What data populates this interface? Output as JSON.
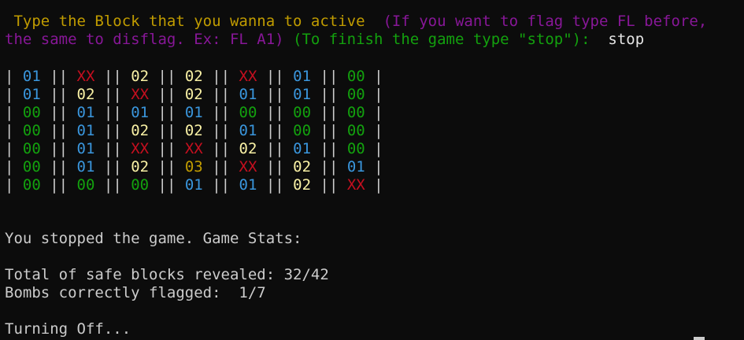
{
  "colors": {
    "background": "#0c0c0c",
    "prompt_gold": "#c19c00",
    "prompt_purple": "#881798",
    "prompt_green": "#13a10e",
    "text": "#cccccc",
    "user_input": "#e6e6e6",
    "value_00": "#13a10e",
    "value_01": "#3a96dd",
    "value_02": "#f9f1a5",
    "value_03": "#c19c00",
    "value_XX": "#c50f1f"
  },
  "prompt": {
    "gold": " Type the Block that you wanna to active ",
    "purple_1": " (If you want to flag type FL before,",
    "purple_2": "the same to disflag. Ex: FL A1)",
    "green": " (To finish the game type \"stop\"):",
    "input": "  stop"
  },
  "grid": {
    "rows": [
      [
        "01",
        "XX",
        "02",
        "02",
        "XX",
        "01",
        "00"
      ],
      [
        "01",
        "02",
        "XX",
        "02",
        "01",
        "01",
        "00"
      ],
      [
        "00",
        "01",
        "01",
        "01",
        "00",
        "00",
        "00"
      ],
      [
        "00",
        "01",
        "02",
        "02",
        "01",
        "00",
        "00"
      ],
      [
        "00",
        "01",
        "XX",
        "XX",
        "02",
        "01",
        "00"
      ],
      [
        "00",
        "01",
        "02",
        "03",
        "XX",
        "02",
        "01"
      ],
      [
        "00",
        "00",
        "00",
        "01",
        "01",
        "02",
        "XX"
      ]
    ]
  },
  "output": {
    "stopped": "You stopped the game. Game Stats:",
    "safe_label": "Total of safe blocks revealed: ",
    "safe_value": "32/42",
    "bombs_label": "Bombs correctly flagged:  ",
    "bombs_value": "1/7",
    "turning_off": "Turning Off..."
  }
}
